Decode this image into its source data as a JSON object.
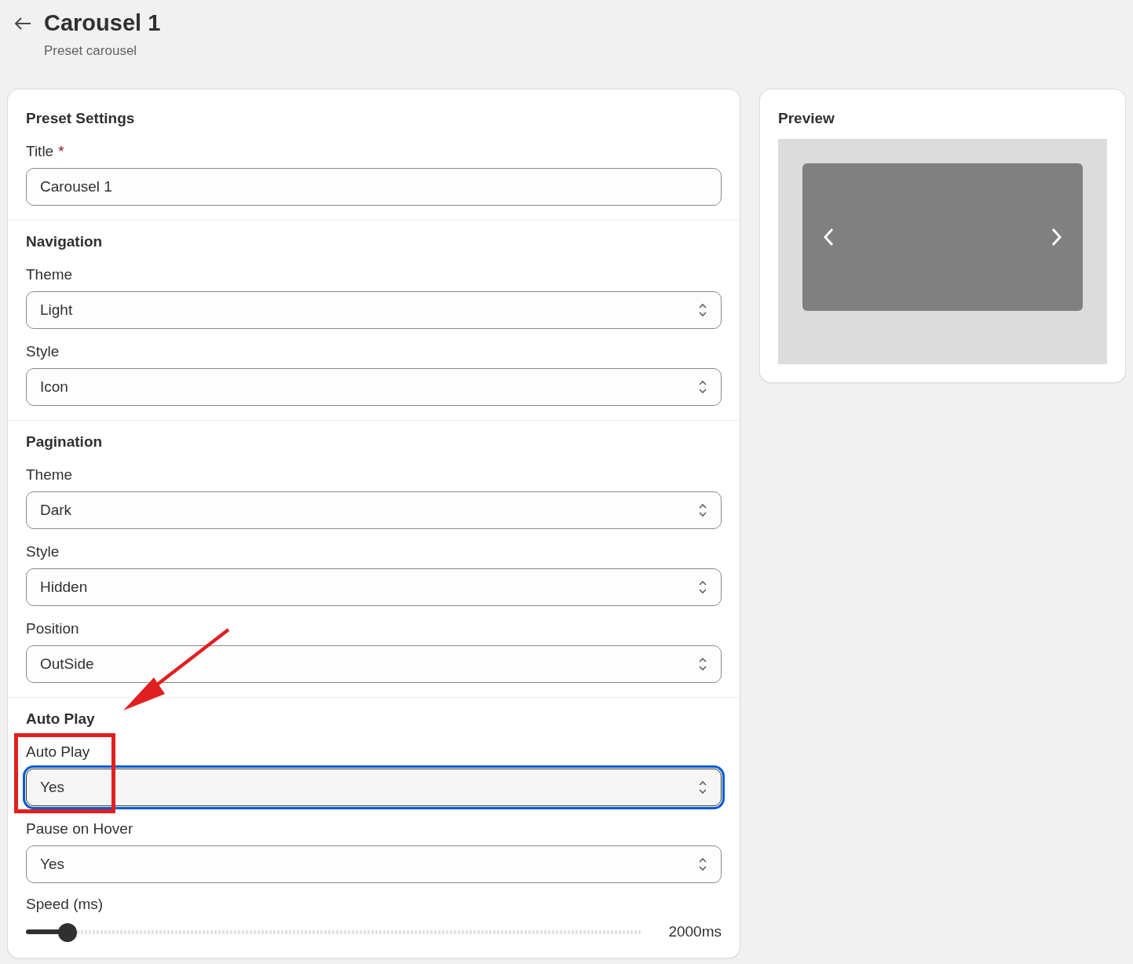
{
  "header": {
    "title": "Carousel 1",
    "subtitle": "Preset carousel"
  },
  "sections": [
    {
      "heading": "Preset Settings",
      "fields": [
        {
          "kind": "text",
          "label": "Title",
          "required_mark": "*",
          "value": "Carousel 1"
        }
      ]
    },
    {
      "heading": "Navigation",
      "fields": [
        {
          "kind": "select",
          "label": "Theme",
          "value": "Light",
          "focused": false
        },
        {
          "kind": "select",
          "label": "Style",
          "value": "Icon",
          "focused": false
        }
      ]
    },
    {
      "heading": "Pagination",
      "fields": [
        {
          "kind": "select",
          "label": "Theme",
          "value": "Dark",
          "focused": false
        },
        {
          "kind": "select",
          "label": "Style",
          "value": "Hidden",
          "focused": false
        },
        {
          "kind": "select",
          "label": "Position",
          "value": "OutSide",
          "focused": false
        }
      ]
    },
    {
      "heading": "Auto Play",
      "fields": [
        {
          "kind": "select",
          "label": "Auto Play",
          "value": "Yes",
          "focused": true
        },
        {
          "kind": "select",
          "label": "Pause on Hover",
          "value": "Yes",
          "focused": false
        },
        {
          "kind": "slider",
          "label": "Speed (ms)",
          "level": 0.067,
          "reading": "2000ms"
        }
      ]
    }
  ],
  "preview": {
    "heading": "Preview"
  }
}
